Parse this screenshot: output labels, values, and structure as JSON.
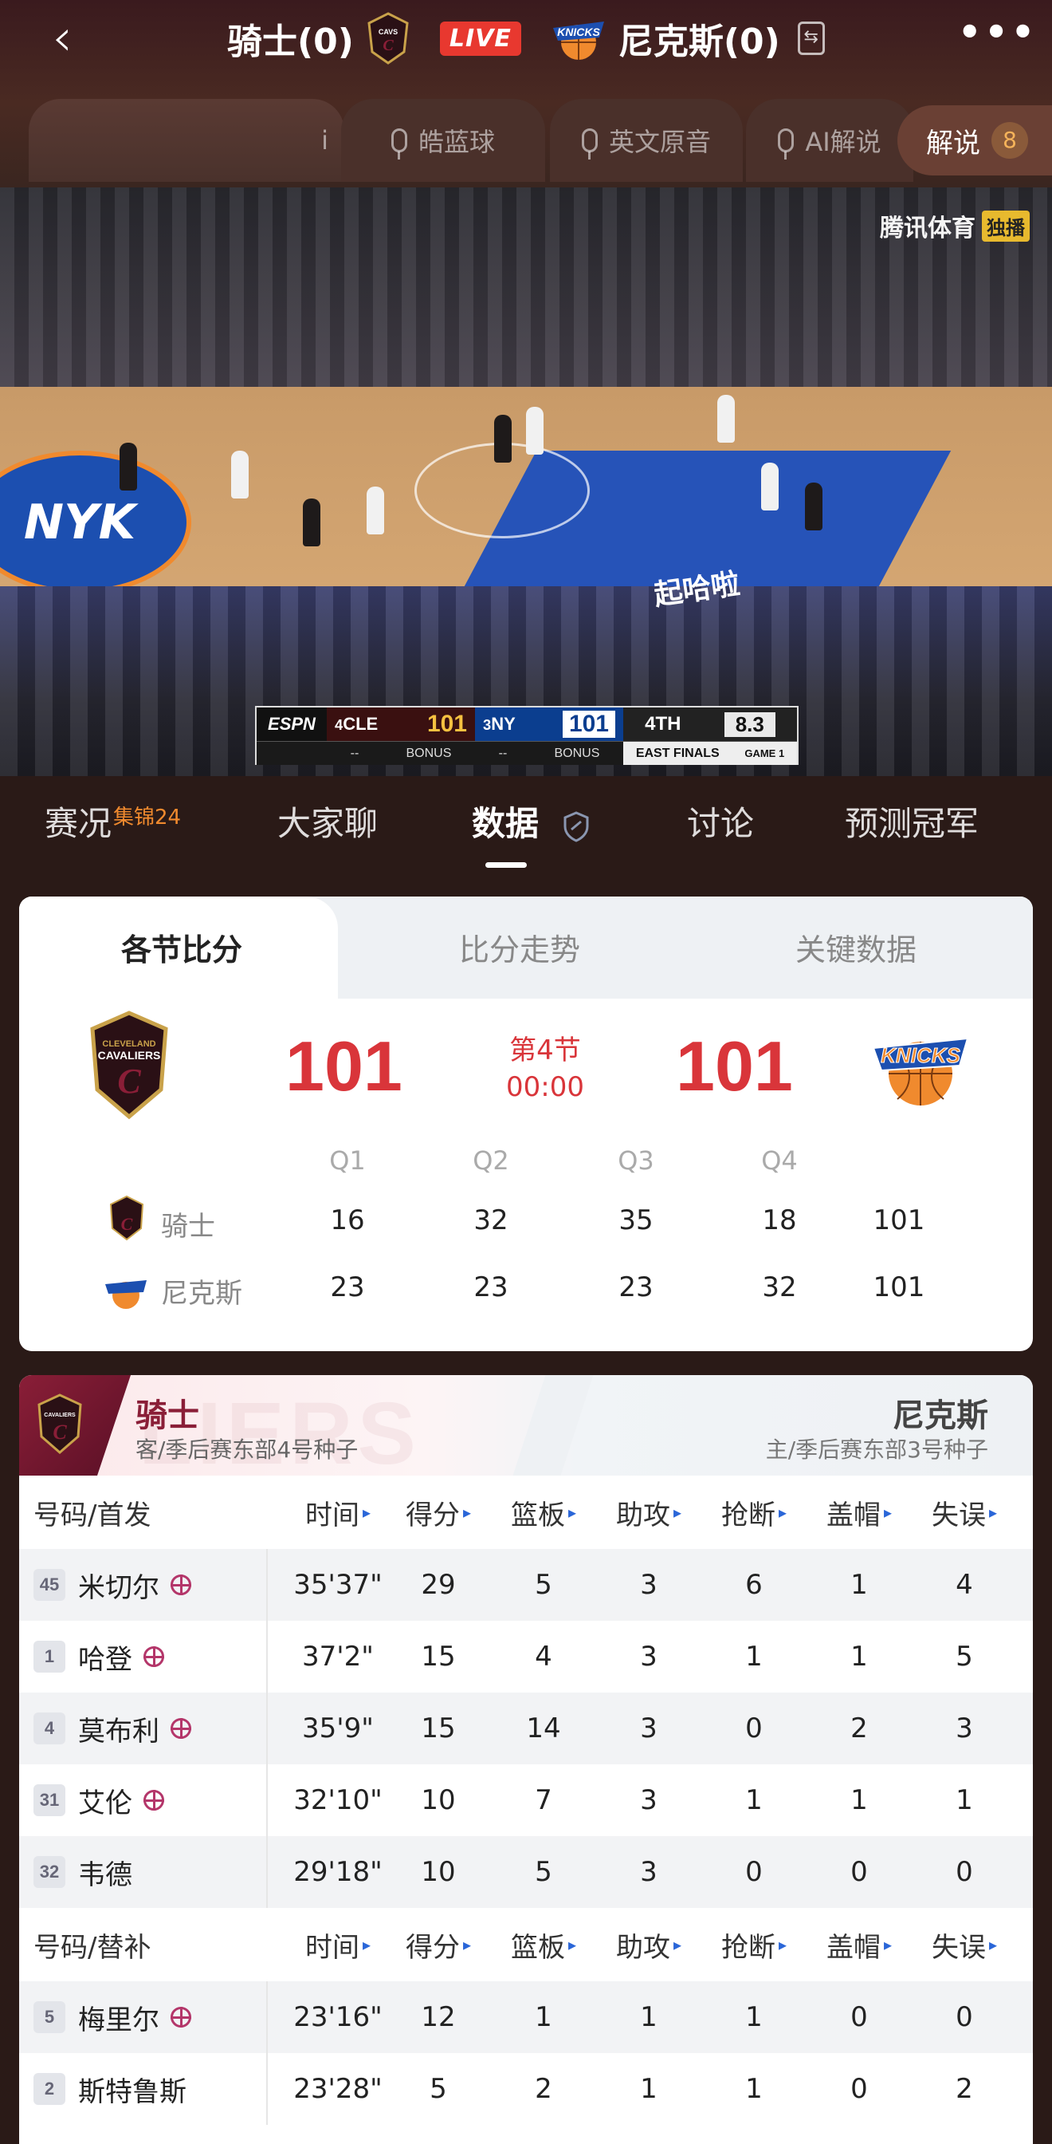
{
  "header": {
    "home_team": "骑士(0)",
    "away_team": "尼克斯(0)",
    "live_label": "LIVE"
  },
  "audio": {
    "first_chip": "i",
    "options": [
      "皓蓝球",
      "英文原音",
      "AI解说"
    ],
    "commentary_label": "解说",
    "commentary_count": "8"
  },
  "video": {
    "broadcaster": "腾讯体育",
    "broadcaster_tag": "独播",
    "floor_text": "起哈啦",
    "scorebug": {
      "network": "ESPN",
      "cle_seed": "4",
      "cle_abbr": "CLE",
      "cle_score": "101",
      "ny_seed": "3",
      "ny_abbr": "NY",
      "ny_score": "101",
      "quarter": "4TH",
      "clock": "8.3",
      "cle_bonus": "BONUS",
      "ny_bonus": "BONUS",
      "series": "EAST FINALS",
      "game": "GAME 1"
    }
  },
  "tabs": [
    {
      "label": "赛况",
      "sup": "集锦24"
    },
    {
      "label": "大家聊"
    },
    {
      "label": "数据"
    },
    {
      "label": "讨论"
    },
    {
      "label": "预测冠军"
    }
  ],
  "score_card": {
    "tabs": [
      "各节比分",
      "比分走势",
      "关键数据"
    ],
    "home_score": "101",
    "away_score": "101",
    "period": "第4节",
    "clock": "00:00",
    "quarters": [
      "Q1",
      "Q2",
      "Q3",
      "Q4"
    ],
    "rows": [
      {
        "team": "骑士",
        "values": [
          "16",
          "32",
          "35",
          "18",
          "101"
        ]
      },
      {
        "team": "尼克斯",
        "values": [
          "23",
          "23",
          "23",
          "32",
          "101"
        ]
      }
    ]
  },
  "stats": {
    "home_team": "骑士",
    "home_sub": "客/季后赛东部4号种子",
    "away_team": "尼克斯",
    "away_sub": "主/季后赛东部3号种子",
    "watermark": "LIERS",
    "starters_header": [
      "号码/首发",
      "时间",
      "得分",
      "篮板",
      "助攻",
      "抢断",
      "盖帽",
      "失误"
    ],
    "bench_header": [
      "号码/替补",
      "时间",
      "得分",
      "篮板",
      "助攻",
      "抢断",
      "盖帽",
      "失误"
    ],
    "starters": [
      {
        "num": "45",
        "name": "米切尔",
        "ball": true,
        "time": "35'37\"",
        "pts": "29",
        "reb": "5",
        "ast": "3",
        "stl": "6",
        "blk": "1",
        "tov": "4"
      },
      {
        "num": "1",
        "name": "哈登",
        "ball": true,
        "time": "37'2\"",
        "pts": "15",
        "reb": "4",
        "ast": "3",
        "stl": "1",
        "blk": "1",
        "tov": "5"
      },
      {
        "num": "4",
        "name": "莫布利",
        "ball": true,
        "time": "35'9\"",
        "pts": "15",
        "reb": "14",
        "ast": "3",
        "stl": "0",
        "blk": "2",
        "tov": "3"
      },
      {
        "num": "31",
        "name": "艾伦",
        "ball": true,
        "time": "32'10\"",
        "pts": "10",
        "reb": "7",
        "ast": "3",
        "stl": "1",
        "blk": "1",
        "tov": "1"
      },
      {
        "num": "32",
        "name": "韦德",
        "ball": false,
        "time": "29'18\"",
        "pts": "10",
        "reb": "5",
        "ast": "3",
        "stl": "0",
        "blk": "0",
        "tov": "0"
      }
    ],
    "bench": [
      {
        "num": "5",
        "name": "梅里尔",
        "ball": true,
        "time": "23'16\"",
        "pts": "12",
        "reb": "1",
        "ast": "1",
        "stl": "1",
        "blk": "0",
        "tov": "0"
      },
      {
        "num": "2",
        "name": "斯特鲁斯",
        "ball": false,
        "time": "23'28\"",
        "pts": "5",
        "reb": "2",
        "ast": "1",
        "stl": "1",
        "blk": "0",
        "tov": "2"
      }
    ]
  },
  "colors": {
    "accent_red": "#d9353a",
    "cavs_wine": "#8a1e37",
    "knicks_blue": "#1c4fb0",
    "knicks_orange": "#f08a2e",
    "sort_blue": "#2a66d8"
  }
}
